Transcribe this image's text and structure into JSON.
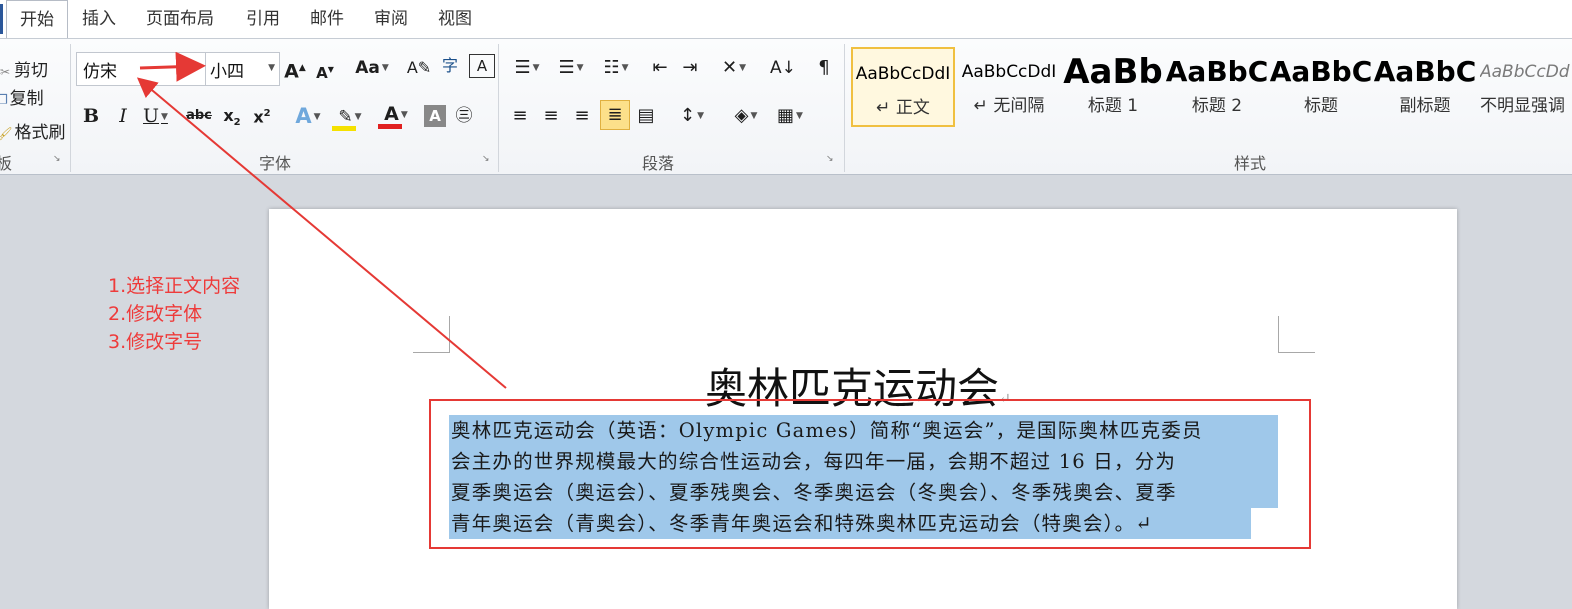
{
  "tabs": [
    "开始",
    "插入",
    "页面布局",
    "引用",
    "邮件",
    "审阅",
    "视图"
  ],
  "clipboard": {
    "cut": "剪切",
    "copy": "复制",
    "format_painter": "格式刷",
    "group_label": "板"
  },
  "font": {
    "name": "仿宋",
    "size": "小四",
    "group_label": "字体",
    "grow": "A",
    "shrink": "A",
    "case": "Aa",
    "strike": "abc",
    "highlight_color": "#f5e100",
    "font_color": "#e02020"
  },
  "paragraph": {
    "group_label": "段落"
  },
  "styles": {
    "group_label": "样式",
    "items": [
      {
        "preview": "AaBbCcDdI",
        "name": "↵ 正文"
      },
      {
        "preview": "AaBbCcDdI",
        "name": "↵ 无间隔"
      },
      {
        "preview": "AaBb",
        "name": "标题 1"
      },
      {
        "preview": "AaBbC",
        "name": "标题 2"
      },
      {
        "preview": "AaBbC",
        "name": "标题"
      },
      {
        "preview": "AaBbC",
        "name": "副标题"
      },
      {
        "preview": "AaBbCcDd",
        "name": "不明显强调"
      }
    ]
  },
  "document": {
    "title": "奥林匹克运动会",
    "para_mark": "↵",
    "lines": [
      "奥林匹克运动会（英语：Olympic Games）简称“奥运会”，是国际奥林匹克委员",
      "会主办的世界规模最大的综合性运动会，每四年一届，会期不超过 16 日，分为",
      "夏季奥运会（奥运会）、夏季残奥会、冬季奥运会（冬奥会）、冬季残奥会、夏季",
      "青年奥运会（青奥会）、冬季青年奥运会和特殊奥林匹克运动会（特奥会）。↵"
    ]
  },
  "annotations": [
    "1.选择正文内容",
    "2.修改字体",
    "3.修改字号"
  ],
  "colors": {
    "annotation": "#e53935",
    "selection": "#9fc8ea",
    "accent": "#f0c040"
  }
}
